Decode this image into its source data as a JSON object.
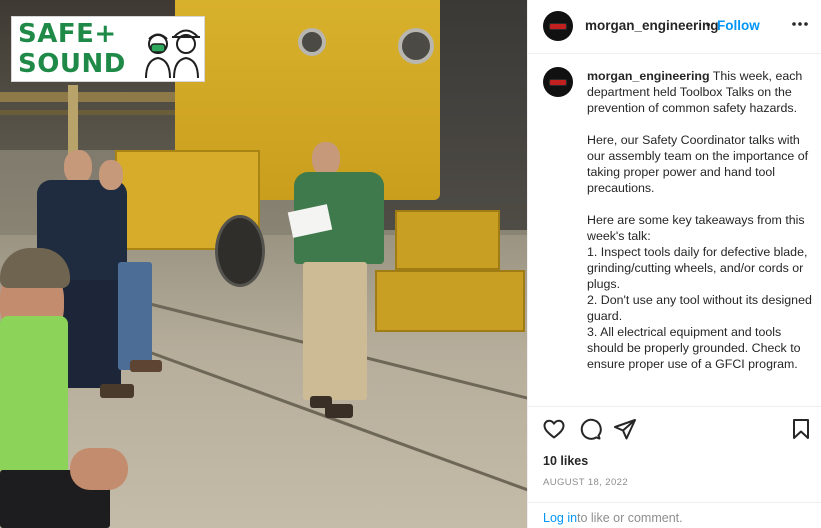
{
  "post_image": {
    "logo": {
      "line1": "SAFE+",
      "line2": "SOUND"
    }
  },
  "header": {
    "username": "morgan_engineering",
    "separator": "•",
    "follow_label": "Follow",
    "more_icon": "more-horizontal-icon"
  },
  "caption": {
    "username": "morgan_engineering",
    "paragraph1": "This week, each department held Toolbox Talks on the prevention of common safety hazards.",
    "paragraph2": "Here, our Safety Coordinator talks with our assembly team on the importance of taking proper power and hand tool precautions.",
    "paragraph3": "Here are some key takeaways from this week's talk:\n1. Inspect tools daily for defective blade, grinding/cutting wheels, and/or cords or plugs.\n2. Don't use any tool without its designed guard.\n3. All electrical equipment and tools should be properly grounded. Check to ensure proper use of a GFCI program."
  },
  "actions": {
    "like_icon": "heart-icon",
    "comment_icon": "comment-icon",
    "share_icon": "share-icon",
    "save_icon": "bookmark-icon"
  },
  "likes_text": "10 likes",
  "date_text": "AUGUST 18, 2022",
  "footer": {
    "login_label": "Log in",
    "rest_text": "to like or comment."
  },
  "colors": {
    "accent": "#0095f6",
    "brand_green": "#1f8a47",
    "text": "#262626",
    "muted": "#8e8e8e"
  }
}
